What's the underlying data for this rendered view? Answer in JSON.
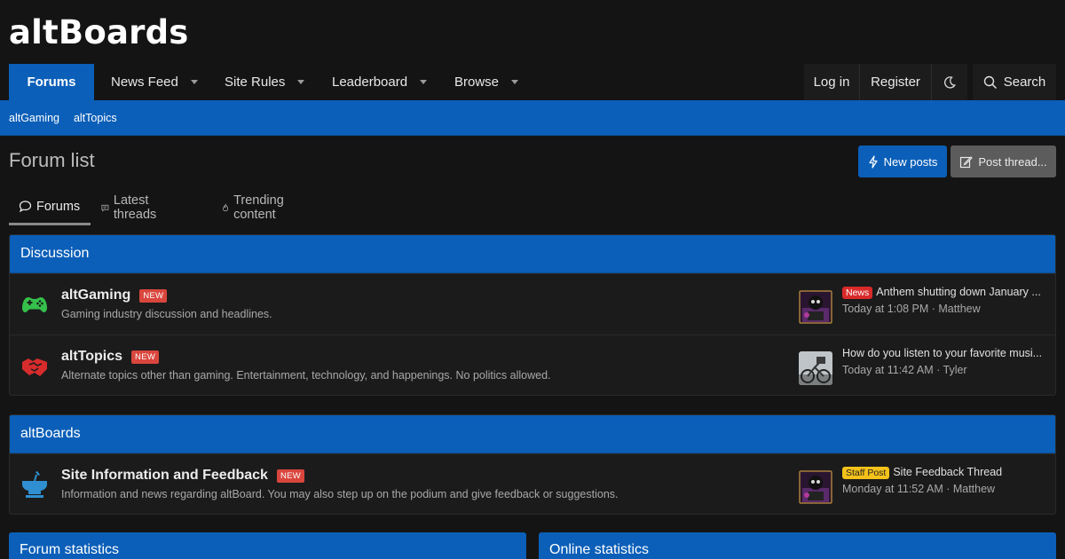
{
  "site": {
    "logo": "altBoards"
  },
  "nav": {
    "items": [
      {
        "label": "Forums"
      },
      {
        "label": "News Feed"
      },
      {
        "label": "Site Rules"
      },
      {
        "label": "Leaderboard"
      },
      {
        "label": "Browse"
      }
    ],
    "login": "Log in",
    "register": "Register",
    "search": "Search"
  },
  "subnav": {
    "items": [
      "altGaming",
      "altTopics"
    ]
  },
  "page": {
    "title": "Forum list"
  },
  "buttons": {
    "new_posts": "New posts",
    "post_thread": "Post thread..."
  },
  "tabs": [
    "Forums",
    "Latest threads",
    "Trending content"
  ],
  "categories": [
    {
      "title": "Discussion",
      "nodes": [
        {
          "title": "altGaming",
          "badge": "NEW",
          "description": "Gaming industry discussion and headlines.",
          "last_prefix": "News",
          "last_title": "Anthem shutting down January ...",
          "last_meta": "Today at 1:08 PM · Matthew"
        },
        {
          "title": "altTopics",
          "badge": "NEW",
          "description": "Alternate topics other than gaming. Entertainment, technology, and happenings. No politics allowed.",
          "last_title": "How do you listen to your favorite musi...",
          "last_meta": "Today at 11:42 AM · Tyler"
        }
      ]
    },
    {
      "title": "altBoards",
      "nodes": [
        {
          "title": "Site Information and Feedback",
          "badge": "NEW",
          "description": "Information and news regarding altBoard. You may also step up on the podium and give feedback or suggestions.",
          "last_prefix": "Staff Post",
          "last_title": "Site Feedback Thread",
          "last_meta": "Monday at 11:52 AM · Matthew"
        }
      ]
    }
  ],
  "stats": {
    "forum": "Forum statistics",
    "online": "Online statistics"
  },
  "colors": {
    "accent": "#0b5fb8",
    "new_badge": "#d9463d",
    "news_prefix": "#d92a2a",
    "staff_prefix": "#f4c21a"
  }
}
